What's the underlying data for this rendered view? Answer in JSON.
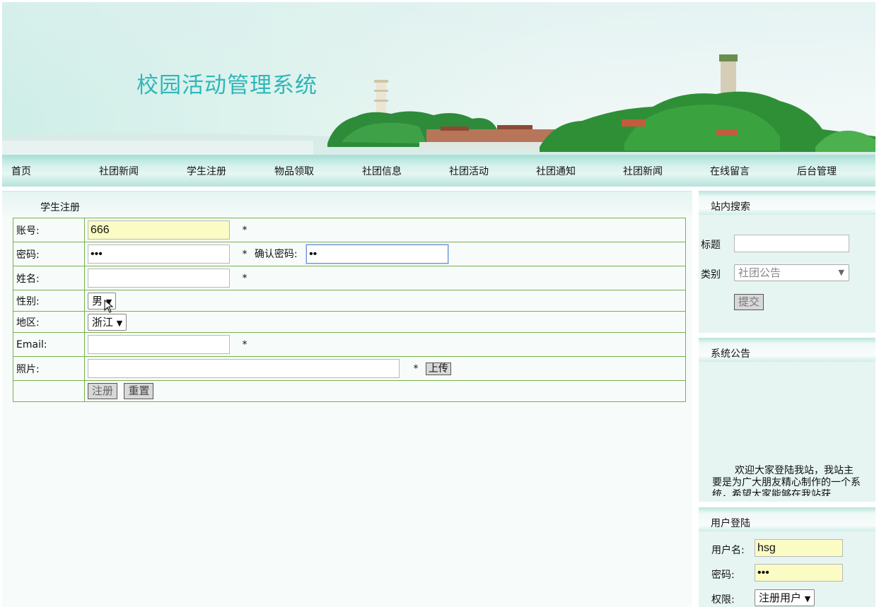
{
  "header": {
    "title": "校园活动管理系统"
  },
  "nav": {
    "items": [
      "首页",
      "社团新闻",
      "学生注册",
      "物品领取",
      "社团信息",
      "社团活动",
      "社团通知",
      "社团新闻",
      "在线留言",
      "后台管理"
    ]
  },
  "register": {
    "heading": "学生注册",
    "account_label": "账号:",
    "account_value": "666",
    "password_label": "密码:",
    "password_value": "•••",
    "confirm_label": "确认密码:",
    "confirm_value": "••",
    "name_label": "姓名:",
    "gender_label": "性别:",
    "gender_value": "男",
    "region_label": "地区:",
    "region_value": "浙江",
    "email_label": "Email:",
    "photo_label": "照片:",
    "required_mark": "*",
    "upload_label": "上传",
    "submit_label": "注册",
    "reset_label": "重置"
  },
  "search": {
    "heading": "站内搜索",
    "title_label": "标题",
    "category_label": "类别",
    "category_value": "社团公告",
    "submit_label": "提交"
  },
  "notice": {
    "heading": "系统公告",
    "text": "欢迎大家登陆我站，我站主要是为广大朋友精心制作的一个系统，希望大家能够在我站获"
  },
  "login": {
    "heading": "用户登陆",
    "username_label": "用户名:",
    "username_value": "hsg",
    "password_label": "密码:",
    "password_value": "•••",
    "role_label": "权限:",
    "role_value": "注册用户"
  },
  "colors": {
    "title": "#2fb7b9",
    "table_border": "#78b24a",
    "input_highlight": "#fbfbc4"
  }
}
